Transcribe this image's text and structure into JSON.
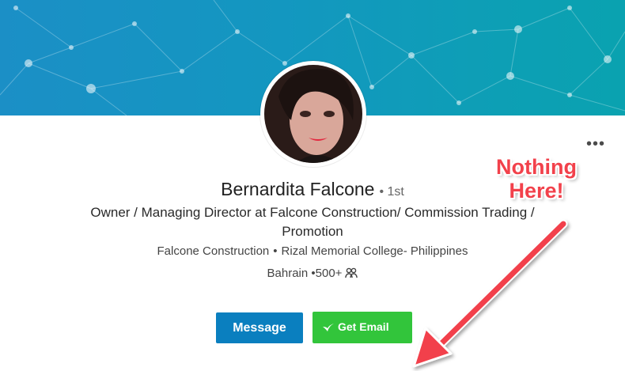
{
  "profile": {
    "name": "Bernardita Falcone",
    "degree": "• 1st",
    "headline": "Owner / Managing Director at Falcone Construction/ Commission Trading / Promotion",
    "company": "Falcone Construction",
    "school": "Rizal Memorial College- Philippines",
    "location": "Bahrain",
    "connections": "•500+",
    "connections_icon": "people-icon"
  },
  "actions": {
    "message_label": "Message",
    "get_email_label": "Get Email",
    "more_label": "•••"
  },
  "annotation": {
    "line1": "Nothing",
    "line2": "Here!",
    "color": "#f2414b"
  },
  "colors": {
    "banner": "#1397c0",
    "message_button": "#0a7fbf",
    "email_button": "#32c53b"
  }
}
